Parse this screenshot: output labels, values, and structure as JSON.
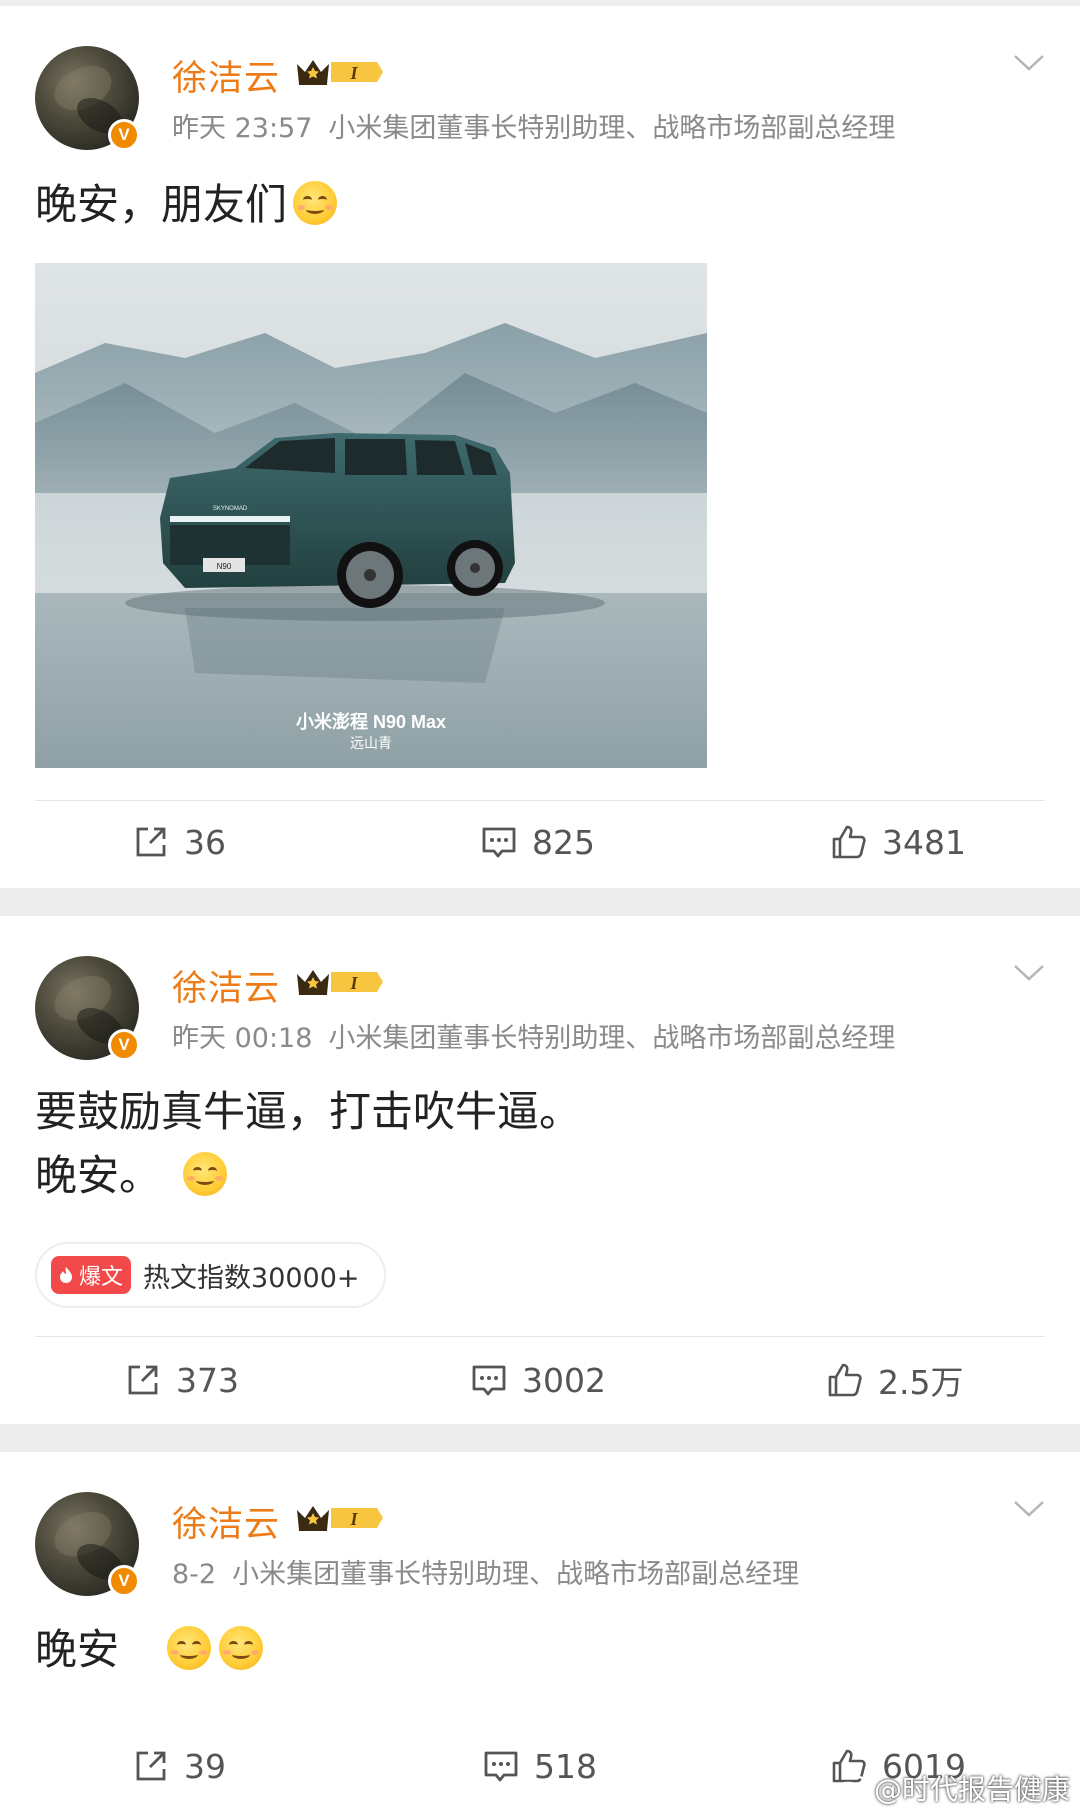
{
  "posts": [
    {
      "username": "徐洁云",
      "time": "昨天 23:57",
      "title": "小米集团董事长特别助理、战略市场部副总经理",
      "text": "晚安，朋友们",
      "image": {
        "caption": "小米澎程 N90 Max",
        "subcaption": "远山青",
        "plate": "N90",
        "grille_text": "SKYNOMAD"
      },
      "reposts": "36",
      "comments": "825",
      "likes": "3481"
    },
    {
      "username": "徐洁云",
      "time": "昨天 00:18",
      "title": "小米集团董事长特别助理、战略市场部副总经理",
      "text_line1": "要鼓励真牛逼，打击吹牛逼。",
      "text_line2": "晚安。",
      "hot_tag": "爆文",
      "hot_label": "热文指数30000+",
      "reposts": "373",
      "comments": "3002",
      "likes": "2.5万"
    },
    {
      "username": "徐洁云",
      "time": "8-2",
      "title": "小米集团董事长特别助理、战略市场部副总经理",
      "text": "晚安",
      "reposts": "39",
      "comments": "518",
      "likes": "6019"
    }
  ],
  "badge": {
    "level": "I",
    "verified": "V"
  },
  "icons": [
    "crown-icon",
    "chevron-down-icon",
    "repost-icon",
    "comment-icon",
    "like-icon",
    "smile-emoji-icon",
    "flame-icon",
    "weibo-logo-icon"
  ],
  "watermark": "@时代报告健康",
  "colors": {
    "username": "#ed7c18",
    "verified": "#f08a00",
    "hot_tag": "#f24a4a",
    "background": "#ededed"
  }
}
